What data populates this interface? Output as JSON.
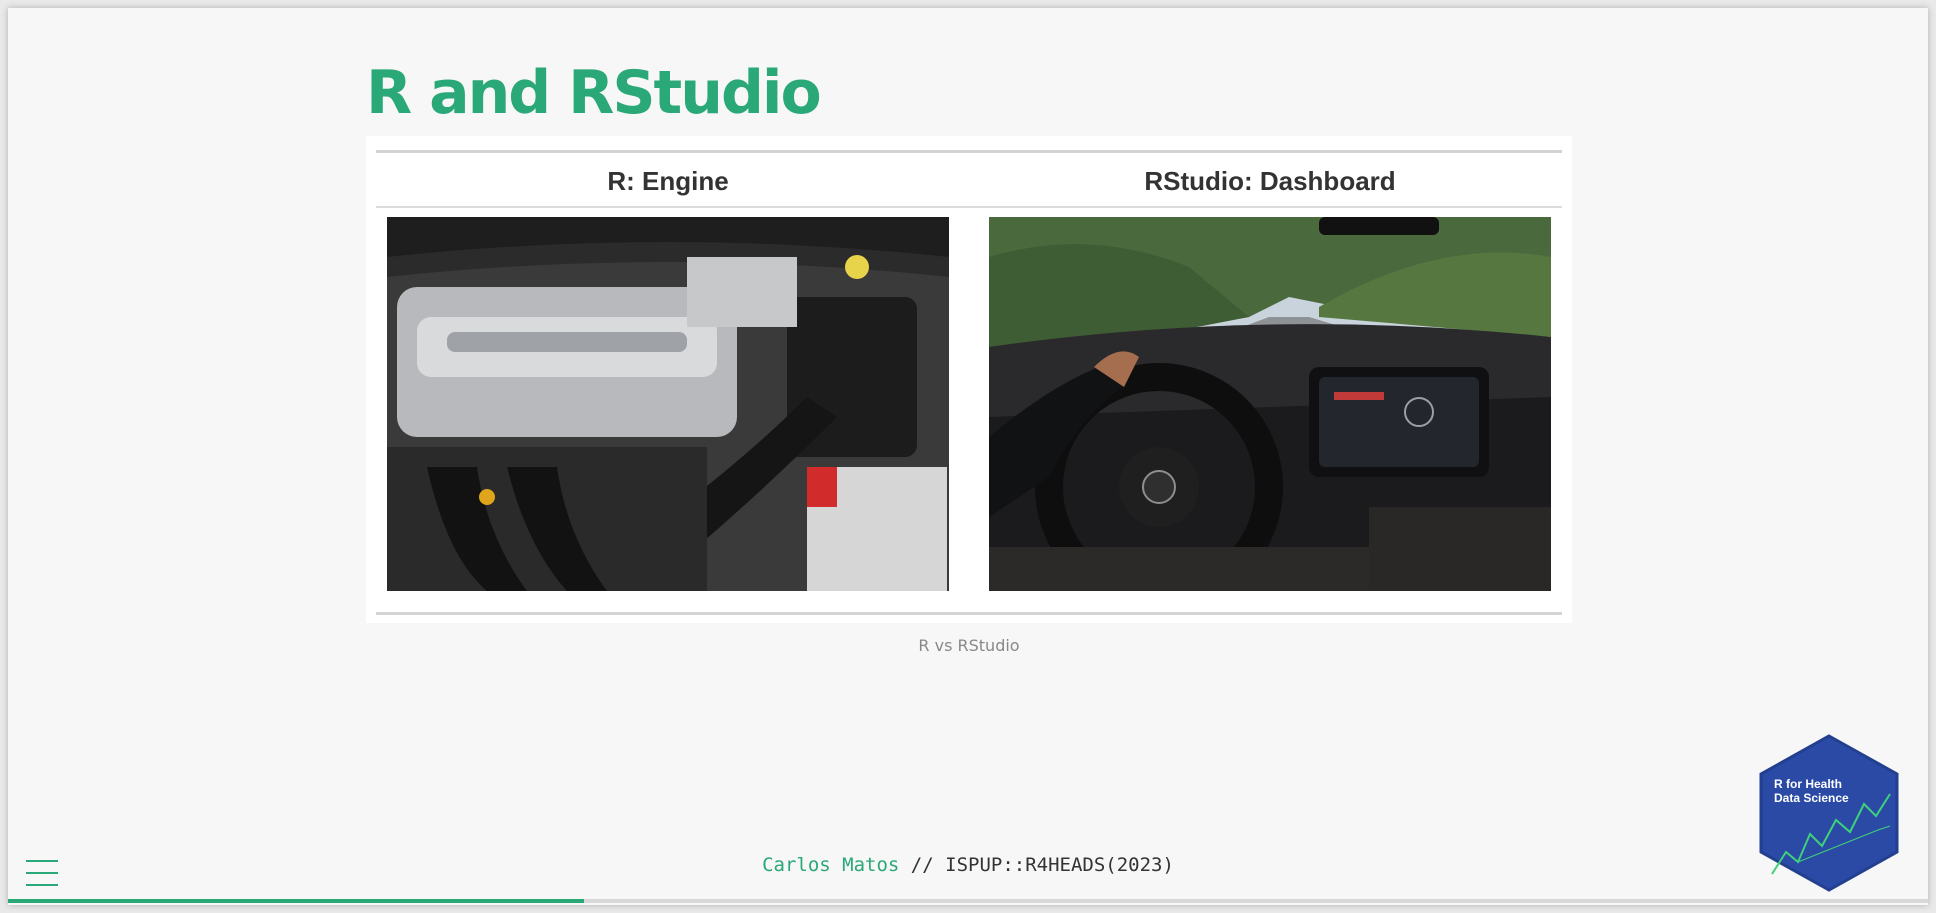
{
  "slide": {
    "title": "R and RStudio",
    "table": {
      "headers": [
        "R: Engine",
        "RStudio: Dashboard"
      ],
      "images": [
        {
          "alt": "Car engine bay photo",
          "icon": "engine-photo"
        },
        {
          "alt": "Car dashboard and steering wheel photo",
          "icon": "dashboard-photo"
        }
      ]
    },
    "caption": "R vs RStudio"
  },
  "footer": {
    "author": "Carlos Matos",
    "separator": " // ",
    "course": "ISPUP::R4HEADS(2023)"
  },
  "menu": {
    "icon": "hamburger-menu-icon"
  },
  "logo": {
    "line1": "R for Health",
    "line2": "Data Science",
    "colors": {
      "bg": "#2a4aa6",
      "accent": "#3fd17a"
    }
  },
  "progress": {
    "fraction": 0.3
  },
  "colors": {
    "accent": "#2aa878",
    "background": "#f7f7f7",
    "text": "#333333"
  }
}
